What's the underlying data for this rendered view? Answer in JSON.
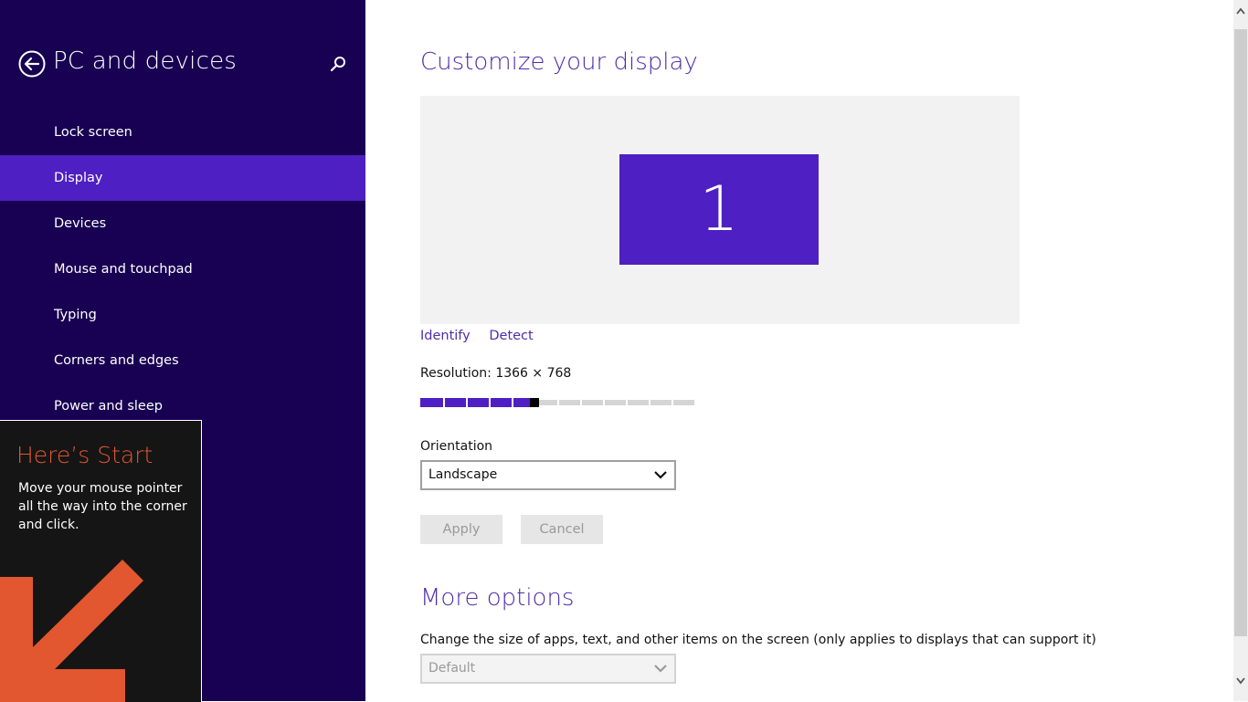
{
  "sidebar": {
    "title": "PC and devices",
    "items": [
      {
        "label": "Lock screen",
        "active": false
      },
      {
        "label": "Display",
        "active": true
      },
      {
        "label": "Devices",
        "active": false
      },
      {
        "label": "Mouse and touchpad",
        "active": false
      },
      {
        "label": "Typing",
        "active": false
      },
      {
        "label": "Corners and edges",
        "active": false
      },
      {
        "label": "Power and sleep",
        "active": false
      }
    ]
  },
  "tip": {
    "title": "Here’s Start",
    "body": "Move your mouse pointer all the way into the corner and click."
  },
  "main": {
    "title": "Customize your display",
    "monitor_number": "1",
    "identify": "Identify",
    "detect": "Detect",
    "resolution_label": "Resolution: 1366 × 768",
    "resolution_slider": {
      "value": 0.4,
      "steps": 12
    },
    "orientation_label": "Orientation",
    "orientation_value": "Landscape",
    "apply": "Apply",
    "cancel": "Cancel",
    "more_title": "More options",
    "more_desc": "Change the size of apps, text, and other items on the screen (only applies to displays that can support it)",
    "size_value": "Default"
  },
  "icons": {
    "back": "back-arrow-icon",
    "search": "search-icon",
    "dropdown": "chevron-down-icon",
    "tip_arrow": "arrow-down-left-icon"
  },
  "colors": {
    "sidebar_bg": "#180052",
    "accent": "#4e1fc2",
    "title_text": "#4f2daa",
    "tip_title": "#e2572f"
  }
}
